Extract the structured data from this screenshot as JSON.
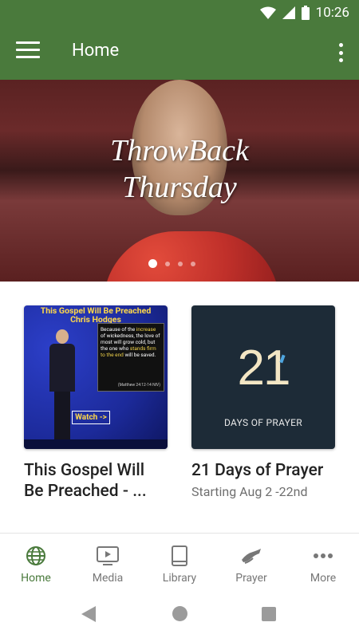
{
  "status": {
    "time": "10:26"
  },
  "appbar": {
    "title": "Home"
  },
  "hero": {
    "title_line1": "ThrowBack",
    "title_line2": "Thursday",
    "slides": 4,
    "active_slide": 1
  },
  "cards": [
    {
      "title": "This Gospel Will Be Preached - ...",
      "subtitle": "",
      "thumb": {
        "heading_line1": "This Gospel Will Be Preached",
        "heading_line2": "Chris Hodges",
        "quote_a": "Because of the ",
        "quote_hl1": "increase",
        "quote_b": " of wickedness, the love of most will grow cold, but the one who ",
        "quote_hl2": "stands firm to the end",
        "quote_c": " will be saved.",
        "reference": "(Matthew 24:12-14 NIV)",
        "watch_label": "Watch ->"
      }
    },
    {
      "title": "21 Days of Prayer",
      "subtitle": "Starting Aug 2 -22nd",
      "thumb": {
        "number": "21",
        "caption": "DAYS OF PRAYER"
      }
    }
  ],
  "nav": {
    "items": [
      {
        "label": "Home",
        "icon": "globe-icon",
        "active": true
      },
      {
        "label": "Media",
        "icon": "tv-icon",
        "active": false
      },
      {
        "label": "Library",
        "icon": "book-icon",
        "active": false
      },
      {
        "label": "Prayer",
        "icon": "praying-hands-icon",
        "active": false
      },
      {
        "label": "More",
        "icon": "more-dots-icon",
        "active": false
      }
    ]
  },
  "colors": {
    "primary": "#4a7a3c",
    "inactive": "#777777"
  }
}
